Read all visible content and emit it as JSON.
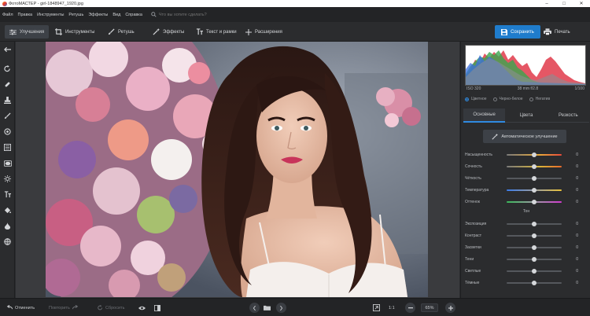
{
  "titlebar": {
    "title": "ФотоМАСТЕР - girl-1848947_1920.jpg",
    "minimize": "–",
    "maximize": "□",
    "close": "✕"
  },
  "menu": {
    "items": [
      "Файл",
      "Правка",
      "Инструменты",
      "Ретушь",
      "Эффекты",
      "Вид",
      "Справка"
    ],
    "search_placeholder": "Что вы хотите сделать?"
  },
  "toolbar": {
    "tabs": [
      "Улучшения",
      "Инструменты",
      "Ретушь",
      "Эффекты",
      "Текст и рамки",
      "Расширения"
    ],
    "active_tab": "Улучшения",
    "save_label": "Сохранить",
    "print_label": "Печать"
  },
  "left_tools": [
    "undo-tool",
    "heal-tool",
    "stamp-tool",
    "brush-tool",
    "radial-tool",
    "gradient-tool",
    "vignette-tool",
    "light-tool",
    "text-tool",
    "fill-tool",
    "color-tool",
    "globe-tool"
  ],
  "panel": {
    "exif": {
      "iso": "ISO 320",
      "lens": "38 mm f/2.8",
      "shutter": "1/100"
    },
    "color_modes": [
      "Цветное",
      "Черно-белое",
      "Негатив"
    ],
    "selected_mode": "Цветное",
    "tabs": [
      "Основные",
      "Цвета",
      "Резкость"
    ],
    "active_tab": "Основные",
    "auto_button": "Автоматическое улучшение",
    "sliders_main": [
      {
        "label": "Насыщенность",
        "value": "0",
        "gradient": "linear-gradient(90deg,#7a7a7a,#e8a93a 60%,#e84a3a)"
      },
      {
        "label": "Сочность",
        "value": "0",
        "gradient": "linear-gradient(90deg,#7a7a7a,#d9b53a 60%,#e86a2a)"
      },
      {
        "label": "Чёткость",
        "value": "0",
        "gradient": "#55585d"
      },
      {
        "label": "Температура",
        "value": "0",
        "gradient": "linear-gradient(90deg,#3a7be8,#9a9da2 50%,#e8c23a)"
      },
      {
        "label": "Оттенок",
        "value": "0",
        "gradient": "linear-gradient(90deg,#3ab85a,#9a9da2 50%,#d23ad0)"
      }
    ],
    "tone_title": "Тон",
    "sliders_tone": [
      {
        "label": "Экспозиция",
        "value": "0"
      },
      {
        "label": "Контраст",
        "value": "0"
      },
      {
        "label": "Засветки",
        "value": "0"
      },
      {
        "label": "Тени",
        "value": "0"
      },
      {
        "label": "Светлые",
        "value": "0"
      },
      {
        "label": "Тёмные",
        "value": "0"
      }
    ]
  },
  "bottom": {
    "undo": "Отменить",
    "redo": "Повторить",
    "reset": "Сбросить",
    "ratio": "1:1",
    "zoom": "65%"
  },
  "colors": {
    "accent": "#1f7ccc",
    "background": "#2b2c2e"
  }
}
